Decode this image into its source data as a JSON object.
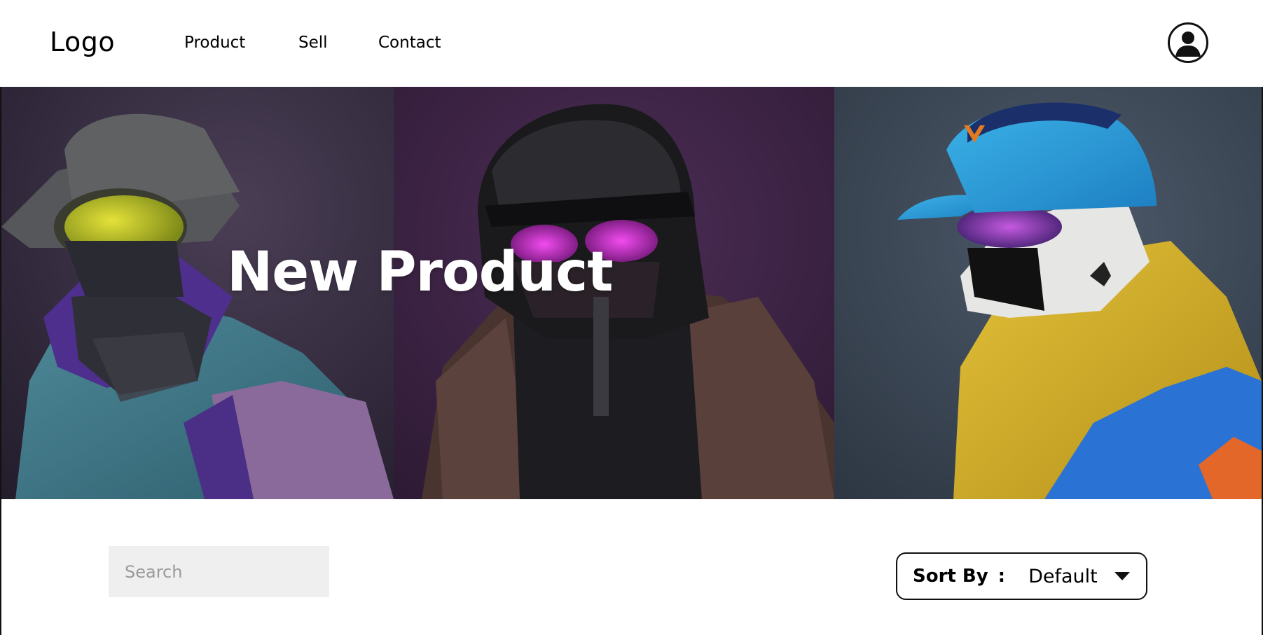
{
  "header": {
    "logo": "Logo",
    "nav": [
      "Product",
      "Sell",
      "Contact"
    ]
  },
  "hero": {
    "title": "New Product"
  },
  "controls": {
    "search_placeholder": "Search",
    "sort_label": "Sort By",
    "sort_colon": ":",
    "sort_value": "Default"
  },
  "colors": {
    "panel1_bg": "#2e2838",
    "panel2_bg": "#3a2440",
    "panel3_bg": "#3a4656",
    "text_primary": "#111111",
    "search_bg": "#efefef"
  },
  "icons": [
    "user-avatar-icon",
    "caret-down-icon"
  ]
}
